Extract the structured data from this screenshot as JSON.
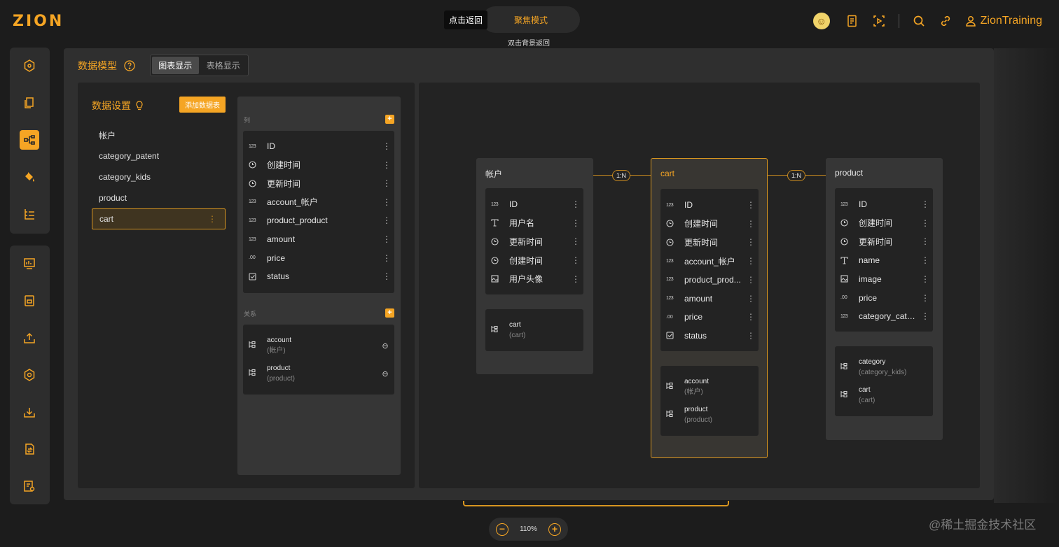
{
  "app": {
    "logo": "ZION"
  },
  "focus": {
    "tooltip": "点击返回",
    "mode_label": "聚焦模式",
    "mode_hint": "双击背景返回"
  },
  "user": {
    "name": "ZionTraining"
  },
  "page": {
    "title": "数据模型",
    "view_chart": "图表显示",
    "view_table": "表格显示"
  },
  "data_settings": {
    "title": "数据设置",
    "add_table": "添加数据表",
    "tables": [
      "帐户",
      "category_patent",
      "category_kids",
      "product",
      "cart"
    ],
    "selected": "cart"
  },
  "column_panel": {
    "columns_label": "列",
    "relations_label": "关系",
    "columns": [
      {
        "icon": "number-icon",
        "name": "ID"
      },
      {
        "icon": "clock-icon",
        "name": "创建时间"
      },
      {
        "icon": "clock-icon",
        "name": "更新时间"
      },
      {
        "icon": "number-icon",
        "name": "account_帐户"
      },
      {
        "icon": "number-icon",
        "name": "product_product"
      },
      {
        "icon": "number-icon",
        "name": "amount"
      },
      {
        "icon": "decimal-icon",
        "name": "price"
      },
      {
        "icon": "checkbox-icon",
        "name": "status"
      }
    ],
    "relations": [
      {
        "name": "account",
        "sub": "(帐户)"
      },
      {
        "name": "product",
        "sub": "(product)"
      }
    ]
  },
  "diagram": {
    "links": [
      "1:N",
      "1:N"
    ],
    "cards": [
      {
        "title": "帐户",
        "fields": [
          {
            "icon": "number-icon",
            "name": "ID"
          },
          {
            "icon": "text-icon",
            "name": "用户名"
          },
          {
            "icon": "clock-icon",
            "name": "更新时间"
          },
          {
            "icon": "clock-icon",
            "name": "创建时间"
          },
          {
            "icon": "image-icon",
            "name": "用户头像"
          }
        ],
        "relations": [
          {
            "name": "cart",
            "sub": "(cart)"
          }
        ]
      },
      {
        "title": "cart",
        "fields": [
          {
            "icon": "number-icon",
            "name": "ID"
          },
          {
            "icon": "clock-icon",
            "name": "创建时间"
          },
          {
            "icon": "clock-icon",
            "name": "更新时间"
          },
          {
            "icon": "number-icon",
            "name": "account_帐户"
          },
          {
            "icon": "number-icon",
            "name": "product_prod..."
          },
          {
            "icon": "number-icon",
            "name": "amount"
          },
          {
            "icon": "decimal-icon",
            "name": "price"
          },
          {
            "icon": "checkbox-icon",
            "name": "status"
          }
        ],
        "relations": [
          {
            "name": "account",
            "sub": "(帐户)"
          },
          {
            "name": "product",
            "sub": "(product)"
          }
        ]
      },
      {
        "title": "product",
        "fields": [
          {
            "icon": "number-icon",
            "name": "ID"
          },
          {
            "icon": "clock-icon",
            "name": "创建时间"
          },
          {
            "icon": "clock-icon",
            "name": "更新时间"
          },
          {
            "icon": "text-icon",
            "name": "name"
          },
          {
            "icon": "image-icon",
            "name": "image"
          },
          {
            "icon": "decimal-icon",
            "name": "price"
          },
          {
            "icon": "number-icon",
            "name": "category_cate..."
          }
        ],
        "relations": [
          {
            "name": "category",
            "sub": "(category_kids)"
          },
          {
            "name": "cart",
            "sub": "(cart)"
          }
        ]
      }
    ]
  },
  "zoom": {
    "value": "110%"
  },
  "watermark": "@稀土掘金技术社区",
  "colors": {
    "accent": "#f5a524",
    "background": "#1c1c1c",
    "panel": "#2f2f2f"
  }
}
